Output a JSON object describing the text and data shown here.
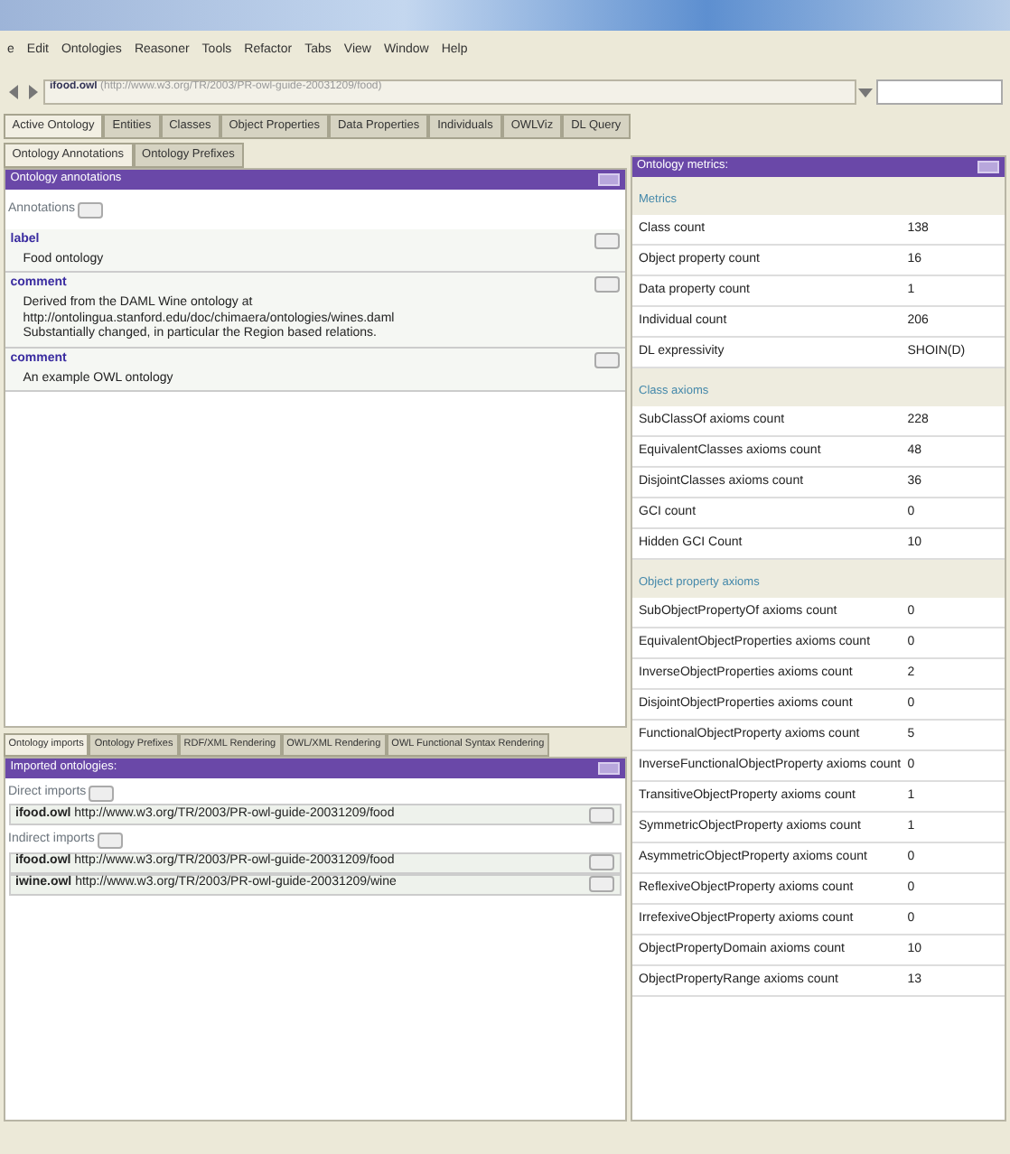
{
  "menu": [
    "e",
    "Edit",
    "Ontologies",
    "Reasoner",
    "Tools",
    "Refactor",
    "Tabs",
    "View",
    "Window",
    "Help"
  ],
  "address": {
    "prefix": "ifood.owl",
    "url": "(http://www.w3.org/TR/2003/PR-owl-guide-20031209/food)"
  },
  "tabs": [
    {
      "label": "Active Ontology",
      "selected": true
    },
    {
      "label": "Entities",
      "selected": false
    },
    {
      "label": "Classes",
      "selected": false
    },
    {
      "label": "Object Properties",
      "selected": false
    },
    {
      "label": "Data Properties",
      "selected": false
    },
    {
      "label": "Individuals",
      "selected": false
    },
    {
      "label": "OWLViz",
      "selected": false
    },
    {
      "label": "DL Query",
      "selected": false
    }
  ],
  "upper": {
    "subtabs": [
      {
        "label": "Ontology Annotations",
        "selected": true
      },
      {
        "label": "Ontology Prefixes",
        "selected": false
      }
    ],
    "title": "Ontology annotations",
    "annotations_label": "Annotations",
    "annotations": [
      {
        "property": "label",
        "lines": [
          "Food ontology"
        ]
      },
      {
        "property": "comment",
        "lines": [
          "Derived from the DAML Wine ontology at",
          "http://ontolingua.stanford.edu/doc/chimaera/ontologies/wines.daml",
          "Substantially changed, in particular the Region based relations."
        ]
      },
      {
        "property": "comment",
        "lines": [
          "An example OWL ontology"
        ]
      }
    ]
  },
  "lower": {
    "subtabs": [
      {
        "label": "Ontology imports",
        "selected": true
      },
      {
        "label": "Ontology Prefixes",
        "selected": false
      },
      {
        "label": "RDF/XML Rendering",
        "selected": false
      },
      {
        "label": "OWL/XML Rendering",
        "selected": false
      },
      {
        "label": "OWL Functional Syntax Rendering",
        "selected": false
      }
    ],
    "title": "Imported ontologies:",
    "direct_label": "Direct imports",
    "direct": [
      {
        "name": "ifood.owl",
        "uri": "http://www.w3.org/TR/2003/PR-owl-guide-20031209/food"
      }
    ],
    "indirect_label": "Indirect imports",
    "indirect": [
      {
        "name": "ifood.owl",
        "uri": "http://www.w3.org/TR/2003/PR-owl-guide-20031209/food"
      },
      {
        "name": "iwine.owl",
        "uri": "http://www.w3.org/TR/2003/PR-owl-guide-20031209/wine"
      }
    ]
  },
  "metrics": {
    "title": "Ontology metrics:",
    "sections": [
      {
        "title": "Metrics",
        "rows": [
          [
            "Class count",
            "138"
          ],
          [
            "Object property count",
            "16"
          ],
          [
            "Data property count",
            "1"
          ],
          [
            "Individual count",
            "206"
          ],
          [
            "DL expressivity",
            "SHOIN(D)"
          ]
        ]
      },
      {
        "title": "Class axioms",
        "rows": [
          [
            "SubClassOf axioms count",
            "228"
          ],
          [
            "EquivalentClasses axioms count",
            "48"
          ],
          [
            "DisjointClasses axioms count",
            "36"
          ],
          [
            "GCI count",
            "0"
          ],
          [
            "Hidden GCI Count",
            "10"
          ]
        ]
      },
      {
        "title": "Object property axioms",
        "rows": [
          [
            "SubObjectPropertyOf axioms count",
            "0"
          ],
          [
            "EquivalentObjectProperties axioms count",
            "0"
          ],
          [
            "InverseObjectProperties axioms count",
            "2"
          ],
          [
            "DisjointObjectProperties axioms count",
            "0"
          ],
          [
            "FunctionalObjectProperty axioms count",
            "5"
          ],
          [
            "InverseFunctionalObjectProperty axioms count",
            "0"
          ],
          [
            "TransitiveObjectProperty axioms count",
            "1"
          ],
          [
            "SymmetricObjectProperty axioms count",
            "1"
          ],
          [
            "AsymmetricObjectProperty axioms count",
            "0"
          ],
          [
            "ReflexiveObjectProperty axioms count",
            "0"
          ],
          [
            "IrrefexiveObjectProperty axioms count",
            "0"
          ],
          [
            "ObjectPropertyDomain axioms count",
            "10"
          ],
          [
            "ObjectPropertyRange axioms count",
            "13"
          ]
        ]
      }
    ]
  }
}
